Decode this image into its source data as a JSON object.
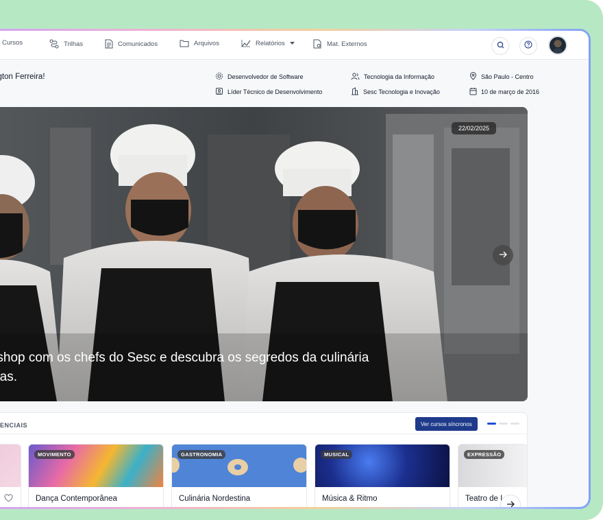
{
  "nav": {
    "items": [
      {
        "label": "Cursos",
        "icon": "courses-icon"
      },
      {
        "label": "Trilhas",
        "icon": "trails-icon"
      },
      {
        "label": "Comunicados",
        "icon": "document-icon"
      },
      {
        "label": "Arquivos",
        "icon": "folder-icon"
      },
      {
        "label": "Relatórios",
        "icon": "chart-icon"
      },
      {
        "label": "Mat. Externos",
        "icon": "external-doc-icon"
      }
    ]
  },
  "user": {
    "greeting": "ashington Ferreira!",
    "role": "Desenvolvedor de Software",
    "title": "Líder Técnico de Desenvolvimento",
    "department": "Tecnologia da Informação",
    "company": "Sesc Tecnologia e Inovação",
    "location": "São Paulo - Centro",
    "since": "10 de março de 2016"
  },
  "hero": {
    "date": "22/02/2025",
    "caption_line1": "orkshop com os chefs do Sesc e descubra os segredos da culinária",
    "caption_line2": "itadas."
  },
  "courses": {
    "section_title": "ENCIAIS",
    "sync_button": "Ver cursos síncronos",
    "cards": [
      {
        "tag": "MOVIMENTO",
        "title": "Dança Contemporânea"
      },
      {
        "tag": "GASTRONOMIA",
        "title": "Culinária Nordestina"
      },
      {
        "tag": "MUSICAL",
        "title": "Música & Ritmo"
      },
      {
        "tag": "EXPRESSÃO",
        "title": "Teatro de I"
      }
    ]
  },
  "colors": {
    "accent": "#1e3a8a",
    "indicator": "#1d4ed8",
    "background": "#b7e8c4"
  }
}
